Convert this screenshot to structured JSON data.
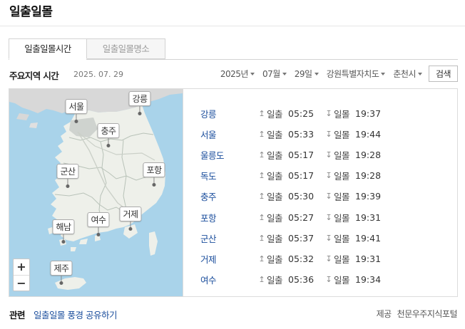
{
  "page": {
    "title": "일출일몰"
  },
  "tabs": [
    {
      "label": "일출일몰시간",
      "active": true
    },
    {
      "label": "일출일몰명소",
      "active": false
    }
  ],
  "region": {
    "heading": "주요지역 시간",
    "date": "2025. 07. 29"
  },
  "selectors": {
    "year": "2025년",
    "month": "07월",
    "day": "29일",
    "province": "강원특별자치도",
    "city": "춘천시"
  },
  "search_button": "검색",
  "map": {
    "labels": {
      "seoul": "서울",
      "gangneung": "강릉",
      "chungju": "충주",
      "gunsan": "군산",
      "pohang": "포항",
      "yeosu": "여수",
      "geoje": "거제",
      "haenam": "해남",
      "jeju": "제주"
    },
    "zoom_in": "+",
    "zoom_out": "−"
  },
  "times": {
    "rise_label": "일출",
    "set_label": "일몰",
    "rows": [
      {
        "city": "강릉",
        "sunrise": "05:25",
        "sunset": "19:37"
      },
      {
        "city": "서울",
        "sunrise": "05:33",
        "sunset": "19:44"
      },
      {
        "city": "울릉도",
        "sunrise": "05:17",
        "sunset": "19:28"
      },
      {
        "city": "독도",
        "sunrise": "05:17",
        "sunset": "19:28"
      },
      {
        "city": "충주",
        "sunrise": "05:30",
        "sunset": "19:39"
      },
      {
        "city": "포항",
        "sunrise": "05:27",
        "sunset": "19:31"
      },
      {
        "city": "군산",
        "sunrise": "05:37",
        "sunset": "19:41"
      },
      {
        "city": "거제",
        "sunrise": "05:32",
        "sunset": "19:31"
      },
      {
        "city": "여수",
        "sunrise": "05:36",
        "sunset": "19:34"
      }
    ]
  },
  "footer": {
    "title": "관련",
    "link": "일출일몰 풍경 공유하기",
    "provider_label": "제공",
    "provider": "천문우주지식포털"
  }
}
